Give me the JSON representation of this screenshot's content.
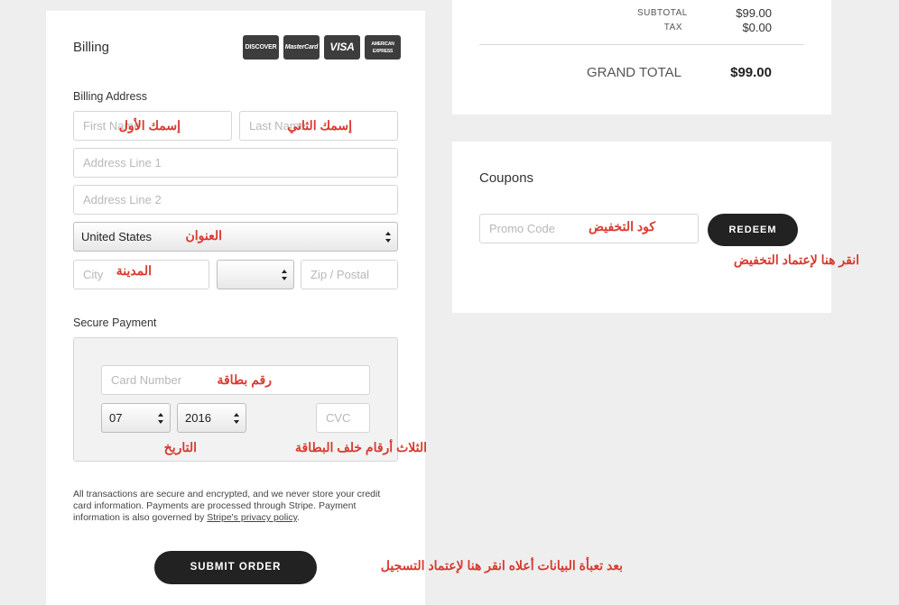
{
  "billing": {
    "title": "Billing",
    "address_label": "Billing Address",
    "first_name_placeholder": "First Name",
    "last_name_placeholder": "Last Name",
    "address1_placeholder": "Address Line 1",
    "address2_placeholder": "Address Line 2",
    "country_value": "United States",
    "city_placeholder": "City",
    "state_value": "",
    "zip_placeholder": "Zip / Postal",
    "cards": [
      "DISCOVER",
      "MasterCard",
      "VISA",
      "AMERICAN EXPRESS"
    ]
  },
  "payment": {
    "title": "Secure Payment",
    "card_number_placeholder": "Card Number",
    "month_value": "07",
    "year_value": "2016",
    "cvc_placeholder": "CVC"
  },
  "disclaimer": {
    "text_before_link": "All transactions are secure and encrypted, and we never store your credit card information. Payments are processed through Stripe. Payment information is also governed by ",
    "link_text": "Stripe's privacy policy",
    "text_after_link": "."
  },
  "submit_label": "SUBMIT ORDER",
  "totals": {
    "subtotal_label": "SUBTOTAL",
    "subtotal_value": "$99.00",
    "tax_label": "TAX",
    "tax_value": "$0.00",
    "grand_total_label": "GRAND TOTAL",
    "grand_total_value": "$99.00"
  },
  "coupons": {
    "title": "Coupons",
    "promo_placeholder": "Promo Code",
    "redeem_label": "REDEEM"
  },
  "annotations": {
    "first_name": "إسمك الأول",
    "last_name": "إسمك الثاني",
    "address": "العنوان",
    "city": "المدينة",
    "card_number": "رقم بطاقة",
    "date": "التاريخ",
    "cvc": "الثلاث أرقام خلف البطاقة",
    "promo": "كود التخفيض",
    "redeem": "انقر هنا لإعتماد التخفيض",
    "submit": "بعد تعبأة البيانات أعلاه انقر هنا لإعتماد التسجيل"
  },
  "colors": {
    "annotation": "#d83a2f",
    "button": "#222222",
    "background": "#eeeeee"
  }
}
